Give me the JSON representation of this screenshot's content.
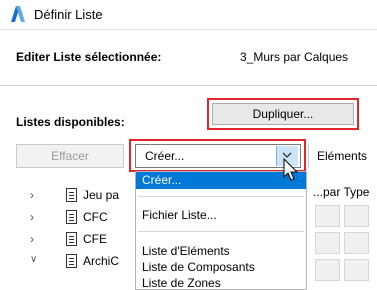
{
  "window": {
    "title": "Définir Liste"
  },
  "header": {
    "edit_label": "Editer Liste sélectionnée:",
    "edit_value": "3_Murs par Calques"
  },
  "toolbar": {
    "available_label": "Listes disponibles:",
    "duplicate_label": "Dupliquer...",
    "erase_label": "Effacer",
    "create_value": "Créer...",
    "elements_tab_label": "Eléments"
  },
  "tree": {
    "items": [
      {
        "label": "Jeu pa",
        "chevron": "right-chevron"
      },
      {
        "label": "CFC",
        "chevron": "right-chevron"
      },
      {
        "label": "CFE",
        "chevron": "right-chevron"
      },
      {
        "label": "ArchiC",
        "chevron": "down-chevron"
      }
    ]
  },
  "dropdown": {
    "items": [
      {
        "label": "Créer...",
        "selected": true
      },
      {
        "label": "Fichier Liste..."
      },
      {
        "label": "Liste d'Eléments"
      },
      {
        "label": "Liste de Composants"
      },
      {
        "label": "Liste de Zones"
      }
    ]
  },
  "right_panel": {
    "type_label": "...par Type"
  },
  "colors": {
    "highlight": "#e3262c",
    "selection": "#0078d7",
    "combo_button": "#cce4f7"
  }
}
